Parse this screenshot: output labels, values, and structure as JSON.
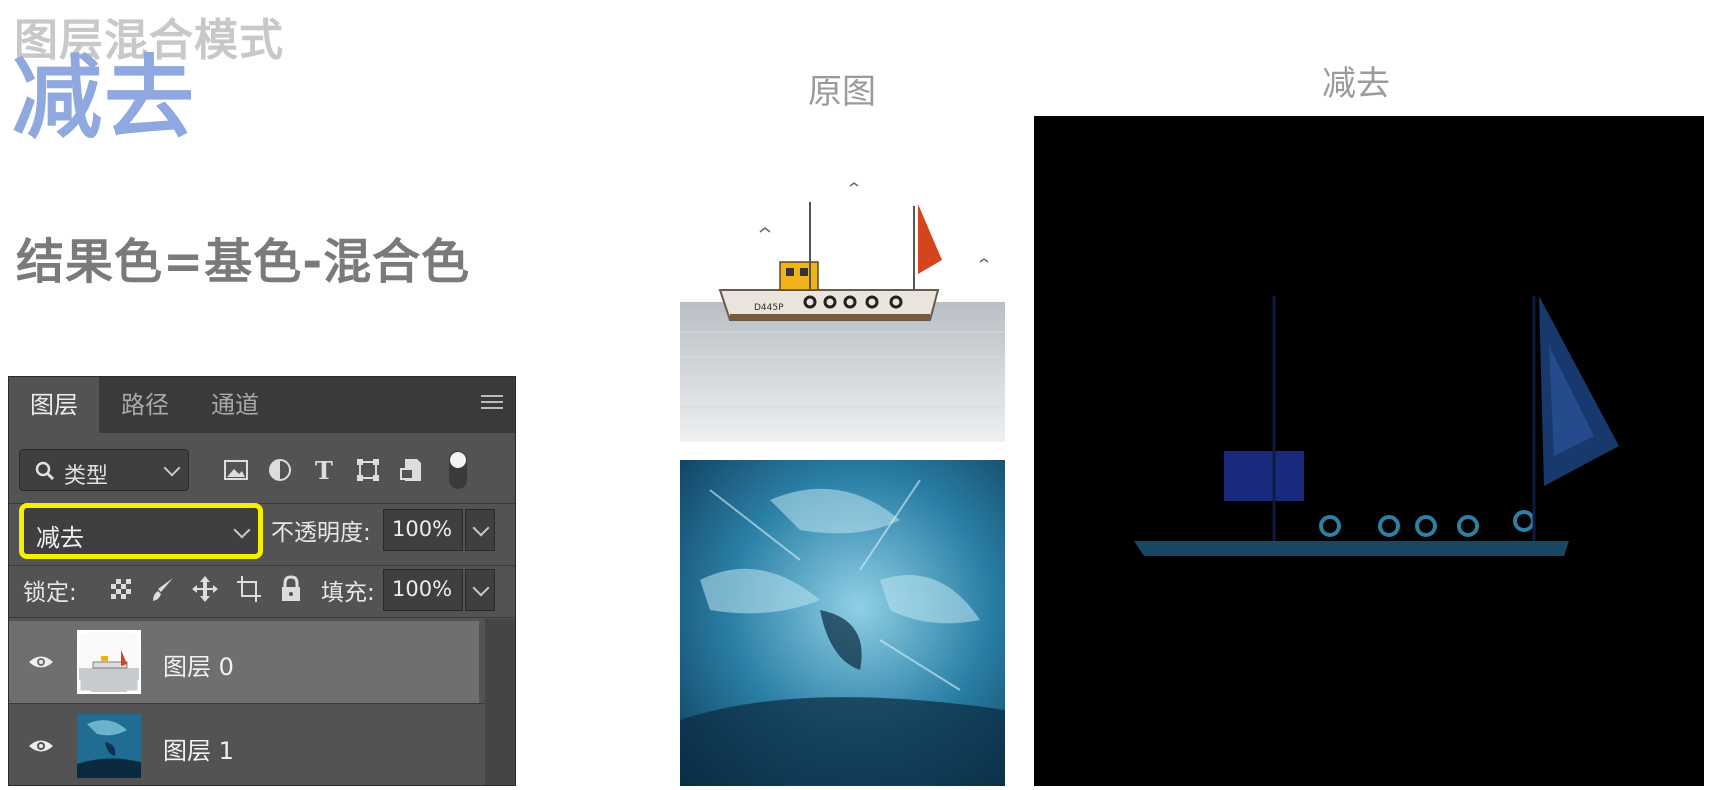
{
  "header": {
    "subtitle": "图层混合模式",
    "title": "减去",
    "formula": "结果色=基色-混合色"
  },
  "labels": {
    "original": "原图",
    "result": "减去"
  },
  "images": {
    "boat_caption": "D445P"
  },
  "panel": {
    "tabs": [
      "图层",
      "路径",
      "通道"
    ],
    "filter_label": "类型",
    "blend_mode": "减去",
    "opacity_label": "不透明度:",
    "opacity_value": "100%",
    "lock_label": "锁定:",
    "fill_label": "填充:",
    "fill_value": "100%",
    "layers": [
      {
        "name": "图层 0"
      },
      {
        "name": "图层 1"
      }
    ]
  },
  "colors": {
    "title_accent": "#8fa9e0",
    "highlight_border": "#f4f000",
    "panel_bg": "#535353"
  }
}
